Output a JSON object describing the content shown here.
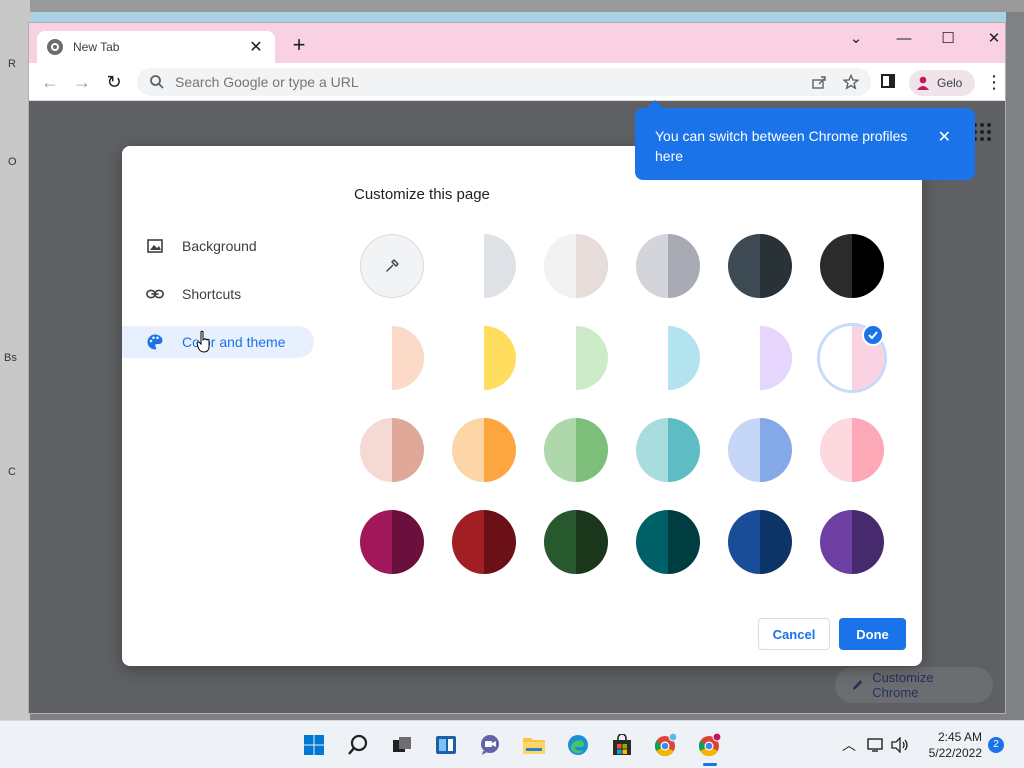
{
  "desktop": {
    "labels": [
      "R",
      "O",
      "Bs",
      "C"
    ]
  },
  "browser": {
    "tab_title": "New Tab",
    "omnibox_placeholder": "Search Google or type a URL",
    "profile_name": "Gelo",
    "accent": "#1a73e8"
  },
  "bubble": {
    "text": "You can switch between Chrome profiles here"
  },
  "dialog": {
    "title": "Customize this page",
    "sidebar": [
      {
        "label": "Background",
        "icon": "image-icon"
      },
      {
        "label": "Shortcuts",
        "icon": "link-icon"
      },
      {
        "label": "Color and theme",
        "icon": "palette-icon",
        "active": true
      }
    ],
    "swatches": [
      [
        "custom-color-picker",
        [
          "#ffffff",
          "#dee1e6"
        ],
        [
          "#f2f2f2",
          "#e6dcd9"
        ],
        [
          "#d3d5da",
          "#a8abb4"
        ],
        [
          "#3d4a53",
          "#283237"
        ],
        [
          "#2b2b2b",
          "#000000"
        ]
      ],
      [
        [
          "#ffffff",
          "#fbdac8"
        ],
        [
          "#ffffff",
          "#ffdd5e"
        ],
        [
          "#ffffff",
          "#cdebc8"
        ],
        [
          "#ffffff",
          "#b3e3ef"
        ],
        [
          "#ffffff",
          "#e6d5fc"
        ],
        [
          "#ffffff",
          "#f9d3e2"
        ]
      ],
      [
        [
          "#f4dad3",
          "#e0a899"
        ],
        [
          "#fdd6a8",
          "#fda63f"
        ],
        [
          "#aed8ab",
          "#7cbe7a"
        ],
        [
          "#a9dcdf",
          "#5dbcc4"
        ],
        [
          "#c6d6f6",
          "#85a9e8"
        ],
        [
          "#fdd8de",
          "#fda8b7"
        ]
      ],
      [
        [
          "#a0185a",
          "#6b0f3c"
        ],
        [
          "#a11e25",
          "#6b1016"
        ],
        [
          "#27582e",
          "#1a371c"
        ],
        [
          "#006067",
          "#003d41"
        ],
        [
          "#1a4d97",
          "#0d3467"
        ],
        [
          "#6d3fa2",
          "#472a6e"
        ]
      ]
    ],
    "selected": [
      1,
      5
    ],
    "cancel_label": "Cancel",
    "done_label": "Done"
  },
  "page": {
    "customize_label": "Customize Chrome"
  },
  "taskbar": {
    "time": "2:45 AM",
    "date": "5/22/2022",
    "notifications": "2"
  }
}
